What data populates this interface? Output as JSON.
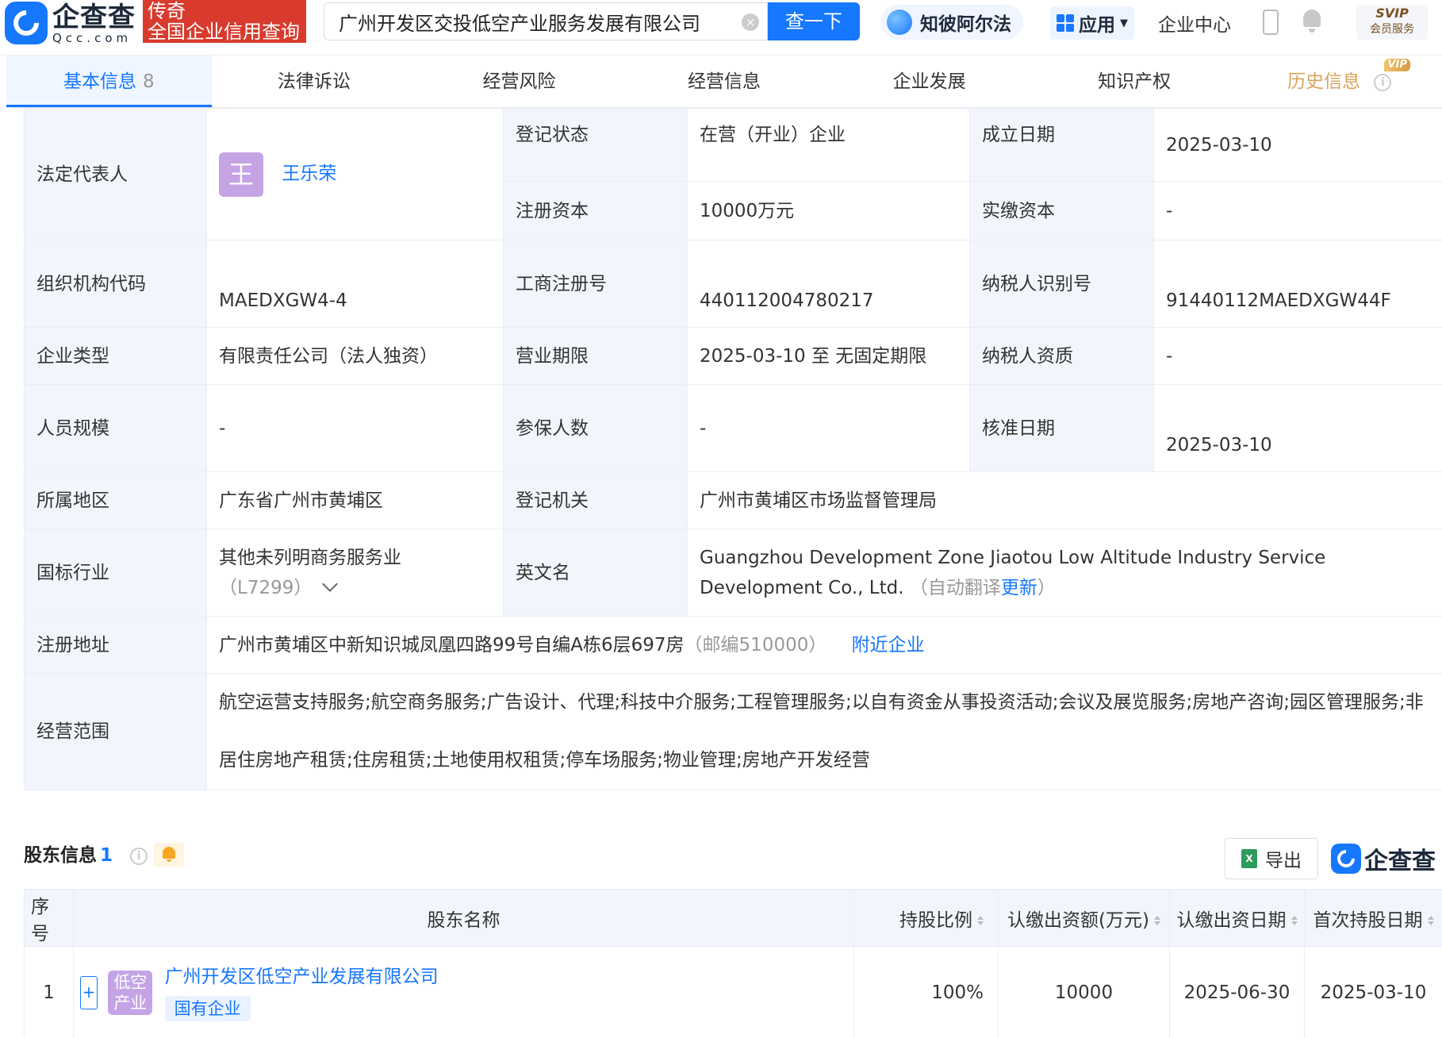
{
  "header": {
    "logo_cn": "企查查",
    "logo_en": "Qcc.com",
    "promo_line1": "传奇",
    "promo_line2": "全国企业信用查询",
    "search_value": "广州开发区交投低空产业服务发展有限公司",
    "search_button": "查一下",
    "ai_label": "知彼阿尔法",
    "apps_label": "应用",
    "enterprise_center": "企业中心",
    "svip_line1": "SVIP",
    "svip_line2": "会员服务"
  },
  "tabs": [
    {
      "label": "基本信息",
      "count": "8"
    },
    {
      "label": "法律诉讼"
    },
    {
      "label": "经营风险"
    },
    {
      "label": "经营信息"
    },
    {
      "label": "企业发展"
    },
    {
      "label": "知识产权"
    },
    {
      "label": "历史信息",
      "badge": "VIP"
    }
  ],
  "info": {
    "legal_rep_label": "法定代表人",
    "legal_rep_avatar": "王",
    "legal_rep_name": "王乐荣",
    "reg_status_label": "登记状态",
    "reg_status": "在营（开业）企业",
    "est_date_label": "成立日期",
    "est_date": "2025-03-10",
    "reg_capital_label": "注册资本",
    "reg_capital": "10000万元",
    "paid_capital_label": "实缴资本",
    "paid_capital": "-",
    "org_code_label": "组织机构代码",
    "org_code": "MAEDXGW4-4",
    "biz_reg_no_label": "工商注册号",
    "biz_reg_no": "440112004780217",
    "taxpayer_id_label": "纳税人识别号",
    "taxpayer_id": "91440112MAEDXGW44F",
    "company_type_label": "企业类型",
    "company_type": "有限责任公司（法人独资）",
    "biz_term_label": "营业期限",
    "biz_term": "2025-03-10 至 无固定期限",
    "taxpayer_qual_label": "纳税人资质",
    "taxpayer_qual": "-",
    "staff_size_label": "人员规模",
    "staff_size": "-",
    "insured_label": "参保人数",
    "insured": "-",
    "approval_date_label": "核准日期",
    "approval_date": "2025-03-10",
    "region_label": "所属地区",
    "region": "广东省广州市黄埔区",
    "reg_authority_label": "登记机关",
    "reg_authority": "广州市黄埔区市场监督管理局",
    "industry_label": "国标行业",
    "industry": "其他未列明商务服务业",
    "industry_code": "（L7299）",
    "english_name_label": "英文名",
    "english_name": "Guangzhou Development Zone Jiaotou Low Altitude Industry Service Development Co., Ltd.",
    "auto_translate": "（自动翻译",
    "update_link": "更新",
    "auto_translate_close": "）",
    "address_label": "注册地址",
    "address": "广州市黄埔区中新知识城凤凰四路99号自编A栋6层697房",
    "postcode": "（邮编510000）",
    "nearby_link": "附近企业",
    "scope_label": "经营范围",
    "scope": "航空运营支持服务;航空商务服务;广告设计、代理;科技中介服务;工程管理服务;以自有资金从事投资活动;会议及展览服务;房地产咨询;园区管理服务;非居住房地产租赁;住房租赁;土地使用权租赁;停车场服务;物业管理;房地产开发经营"
  },
  "shareholders": {
    "title": "股东信息",
    "count": "1",
    "export_label": "导出",
    "watermark_logo": "企查查",
    "columns": [
      "序号",
      "股东名称",
      "持股比例",
      "认缴出资额(万元)",
      "认缴出资日期",
      "首次持股日期"
    ],
    "rows": [
      {
        "index": "1",
        "avatar": "低空产业",
        "name": "广州开发区低空产业发展有限公司",
        "tag": "国有企业",
        "ratio": "100%",
        "amount": "10000",
        "subscribe_date": "2025-06-30",
        "first_hold_date": "2025-03-10"
      }
    ]
  },
  "colors": {
    "brand_blue": "#1677ff",
    "label_bg": "#f2f6fc",
    "promo_red": "#d83b2e",
    "avatar_purple": "#c5a4e6",
    "vip_gold": "#d9a35a"
  }
}
